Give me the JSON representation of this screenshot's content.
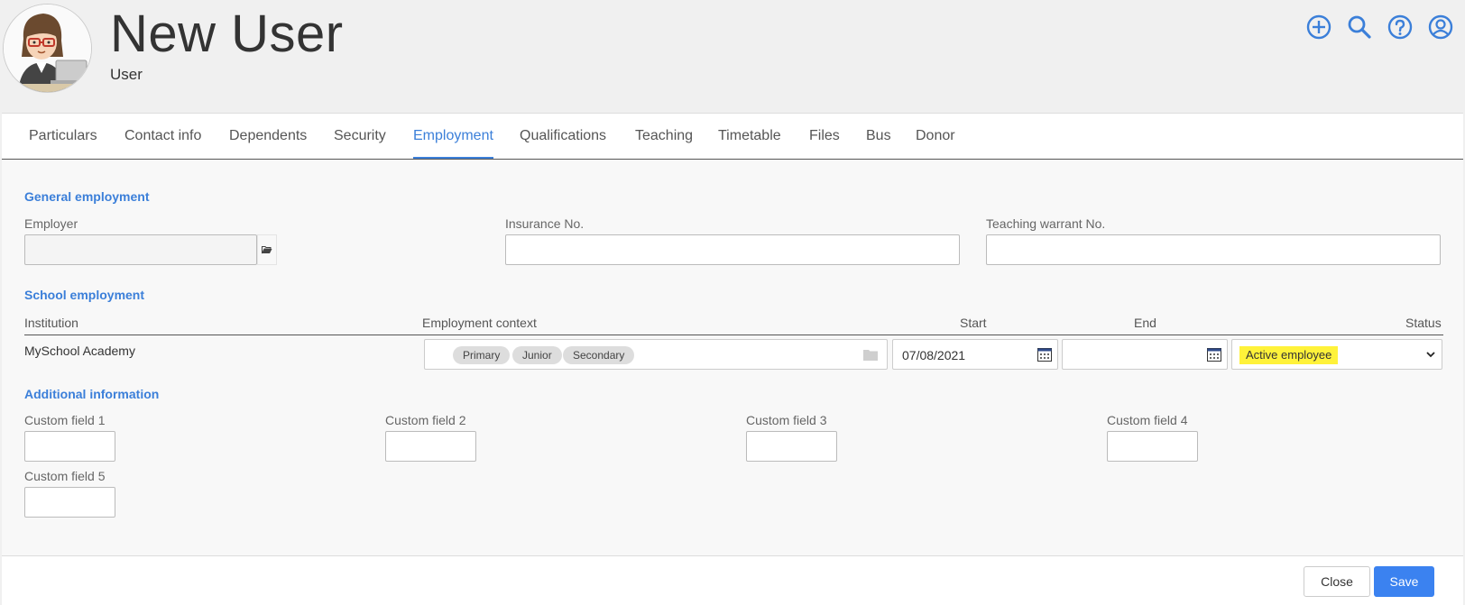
{
  "header": {
    "title": "New User",
    "subtitle": "User",
    "icons": [
      "add-circle-icon",
      "search-icon",
      "help-icon",
      "account-icon"
    ],
    "accent": "#3b7fd9"
  },
  "tabs": [
    {
      "label": "Particulars"
    },
    {
      "label": "Contact info"
    },
    {
      "label": "Dependents"
    },
    {
      "label": "Security"
    },
    {
      "label": "Employment",
      "active": true
    },
    {
      "label": "Qualifications"
    },
    {
      "label": "Teaching"
    },
    {
      "label": "Timetable"
    },
    {
      "label": "Files"
    },
    {
      "label": "Bus"
    },
    {
      "label": "Donor"
    }
  ],
  "general": {
    "title": "General employment",
    "employer_label": "Employer",
    "employer_value": "",
    "insurance_label": "Insurance No.",
    "insurance_value": "",
    "warrant_label": "Teaching warrant No.",
    "warrant_value": ""
  },
  "school": {
    "title": "School employment",
    "columns": {
      "institution": "Institution",
      "context": "Employment context",
      "start": "Start",
      "end": "End",
      "status": "Status"
    },
    "row": {
      "institution": "MySchool Academy",
      "contexts": [
        "Primary",
        "Junior",
        "Secondary"
      ],
      "start": "07/08/2021",
      "end": "",
      "status": "Active employee",
      "status_highlight": "#fff23a"
    }
  },
  "additional": {
    "title": "Additional information",
    "fields": [
      {
        "label": "Custom field 1",
        "value": ""
      },
      {
        "label": "Custom field 2",
        "value": ""
      },
      {
        "label": "Custom field 3",
        "value": ""
      },
      {
        "label": "Custom field 4",
        "value": ""
      },
      {
        "label": "Custom field 5",
        "value": ""
      }
    ]
  },
  "footer": {
    "close_label": "Close",
    "save_label": "Save",
    "save_color": "#3b82f0"
  }
}
